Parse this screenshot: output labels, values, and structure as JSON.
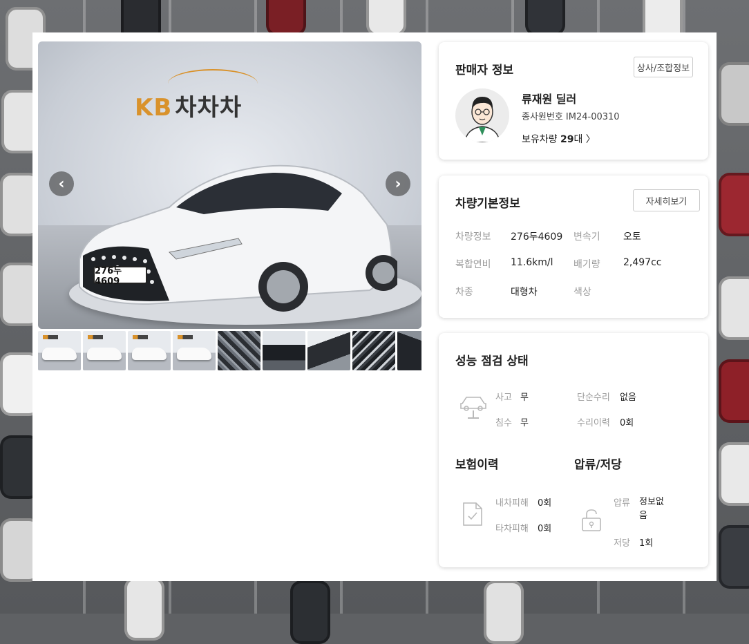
{
  "gallery": {
    "logo_prefix": "KB",
    "logo_name": "차차차",
    "plate": "276두4609",
    "prev_icon": "chevron-left-icon",
    "next_icon": "chevron-right-icon",
    "thumbnail_count": 9
  },
  "seller": {
    "title": "판매자 정보",
    "company_button": "상사/조합정보",
    "dealer_name": "류재원 딜러",
    "employee_id": "종사원번호 IM24-00310",
    "cars_prefix": "보유차량 ",
    "cars_count": "29",
    "cars_suffix": "대 〉"
  },
  "basic_info": {
    "title": "차량기본정보",
    "detail_button": "자세히보기",
    "rows": [
      {
        "label1": "차량정보",
        "value1": "276두4609",
        "label2": "변속기",
        "value2": "오토"
      },
      {
        "label1": "복합연비",
        "value1": "11.6km/l",
        "label2": "배기량",
        "value2": "2,497cc"
      },
      {
        "label1": "차종",
        "value1": "대형차",
        "label2": "색상",
        "value2": ""
      }
    ]
  },
  "inspection": {
    "title": "성능 점검 상태",
    "accident_label": "사고",
    "accident_value": "무",
    "simple_repair_label": "단순수리",
    "simple_repair_value": "없음",
    "flood_label": "침수",
    "flood_value": "무",
    "repair_history_label": "수리이력",
    "repair_history_value": "0회",
    "insurance_title": "보험이력",
    "own_damage_label": "내차피해",
    "own_damage_value": "0회",
    "other_damage_label": "타차피해",
    "other_damage_value": "0회",
    "lien_title": "압류/저당",
    "seizure_label": "압류",
    "seizure_value": "정보없음",
    "mortgage_label": "저당",
    "mortgage_value": "1회"
  },
  "colors": {
    "brand_orange": "#d9922b",
    "muted_label": "#9b9b9b"
  }
}
